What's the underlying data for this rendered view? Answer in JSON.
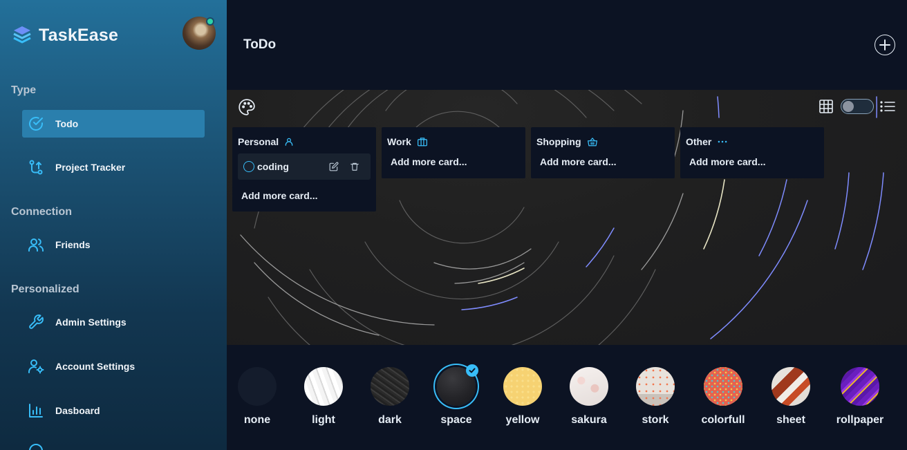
{
  "app": {
    "name": "TaskEase"
  },
  "sidebar": {
    "sections": [
      {
        "title": "Type"
      },
      {
        "title": "Connection"
      },
      {
        "title": "Personalized"
      }
    ],
    "items": [
      {
        "label": "Todo",
        "icon": "check-circle-icon"
      },
      {
        "label": "Project Tracker",
        "icon": "git-branch-icon"
      },
      {
        "label": "Friends",
        "icon": "users-icon"
      },
      {
        "label": "Admin Settings",
        "icon": "wrench-icon"
      },
      {
        "label": "Account Settings",
        "icon": "user-cog-icon"
      },
      {
        "label": "Dasboard",
        "icon": "bar-chart-icon"
      }
    ]
  },
  "header": {
    "title": "ToDo"
  },
  "board": {
    "columns": [
      {
        "title": "Personal",
        "icon": "user-icon",
        "cards": [
          {
            "text": "coding"
          }
        ],
        "add_label": "Add more card..."
      },
      {
        "title": "Work",
        "icon": "briefcase-icon",
        "cards": [],
        "add_label": "Add more card..."
      },
      {
        "title": "Shopping",
        "icon": "basket-icon",
        "cards": [],
        "add_label": "Add more card..."
      },
      {
        "title": "Other",
        "icon": "ellipsis-icon",
        "cards": [],
        "add_label": "Add more card..."
      }
    ]
  },
  "themes": {
    "selected": "space",
    "options": [
      {
        "label": "none"
      },
      {
        "label": "light"
      },
      {
        "label": "dark"
      },
      {
        "label": "space"
      },
      {
        "label": "yellow"
      },
      {
        "label": "sakura"
      },
      {
        "label": "stork"
      },
      {
        "label": "colorfull"
      },
      {
        "label": "sheet"
      },
      {
        "label": "rollpaper"
      }
    ]
  },
  "colors": {
    "accent": "#38bdf8",
    "sidebar_active": "#2a7fad",
    "background": "#0c1323"
  }
}
